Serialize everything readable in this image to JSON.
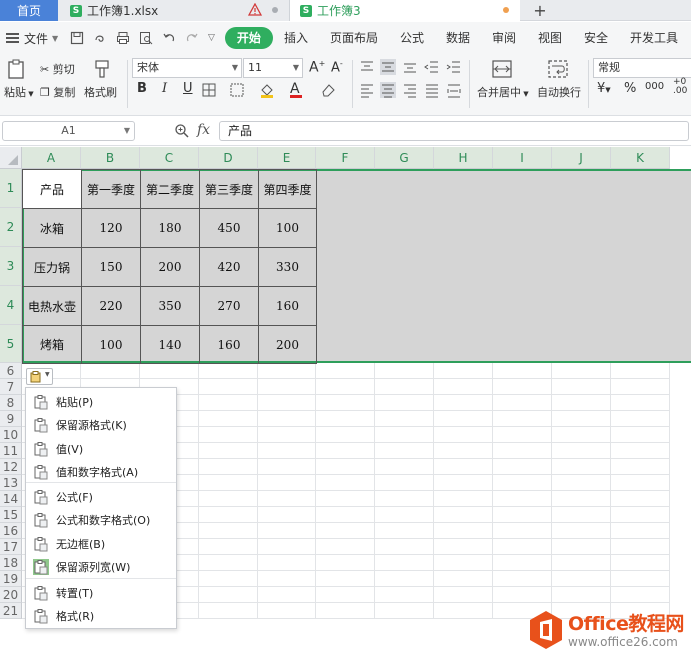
{
  "tabs": {
    "home": "首页",
    "file1": "工作簿1.xlsx",
    "file2": "工作簿3"
  },
  "menu": {
    "file": "文件",
    "tabs": [
      "开始",
      "插入",
      "页面布局",
      "公式",
      "数据",
      "审阅",
      "视图",
      "安全",
      "开发工具"
    ],
    "active_tab": "开始"
  },
  "ribbon": {
    "paste": "粘贴",
    "cut": "剪切",
    "copy": "复制",
    "format_painter": "格式刷",
    "font_name": "宋体",
    "font_size": "11",
    "merge_center": "合并居中",
    "wrap_text": "自动换行",
    "number_format": "常规",
    "bold": "B",
    "italic": "I",
    "underline": "U"
  },
  "formula_bar": {
    "name_box": "A1",
    "fx": "fx",
    "value": "产品"
  },
  "grid": {
    "columns": [
      "A",
      "B",
      "C",
      "D",
      "E",
      "F",
      "G",
      "H",
      "I",
      "J",
      "K"
    ],
    "rows": [
      "1",
      "2",
      "3",
      "4",
      "5",
      "6",
      "7",
      "8",
      "9",
      "10",
      "11",
      "12",
      "13",
      "14",
      "15",
      "16",
      "17",
      "18",
      "19",
      "20",
      "21"
    ]
  },
  "table": {
    "headers": [
      "产品",
      "第一季度",
      "第二季度",
      "第三季度",
      "第四季度"
    ],
    "rows": [
      [
        "冰箱",
        "120",
        "180",
        "450",
        "100"
      ],
      [
        "压力锅",
        "150",
        "200",
        "420",
        "330"
      ],
      [
        "电热水壶",
        "220",
        "350",
        "270",
        "160"
      ],
      [
        "烤箱",
        "100",
        "140",
        "160",
        "200"
      ]
    ]
  },
  "paste_menu": {
    "items": [
      "粘贴(P)",
      "保留源格式(K)",
      "值(V)",
      "值和数字格式(A)",
      "公式(F)",
      "公式和数字格式(O)",
      "无边框(B)",
      "保留源列宽(W)",
      "转置(T)",
      "格式(R)"
    ],
    "highlighted": "保留源列宽(W)"
  },
  "watermark": {
    "title": "Office教程网",
    "url": "www.office26.com"
  },
  "colors": {
    "accent": "#2fae5f",
    "selection_border": "#2e9e5b",
    "home_tab": "#4a82d8",
    "watermark": "#e8511b"
  }
}
